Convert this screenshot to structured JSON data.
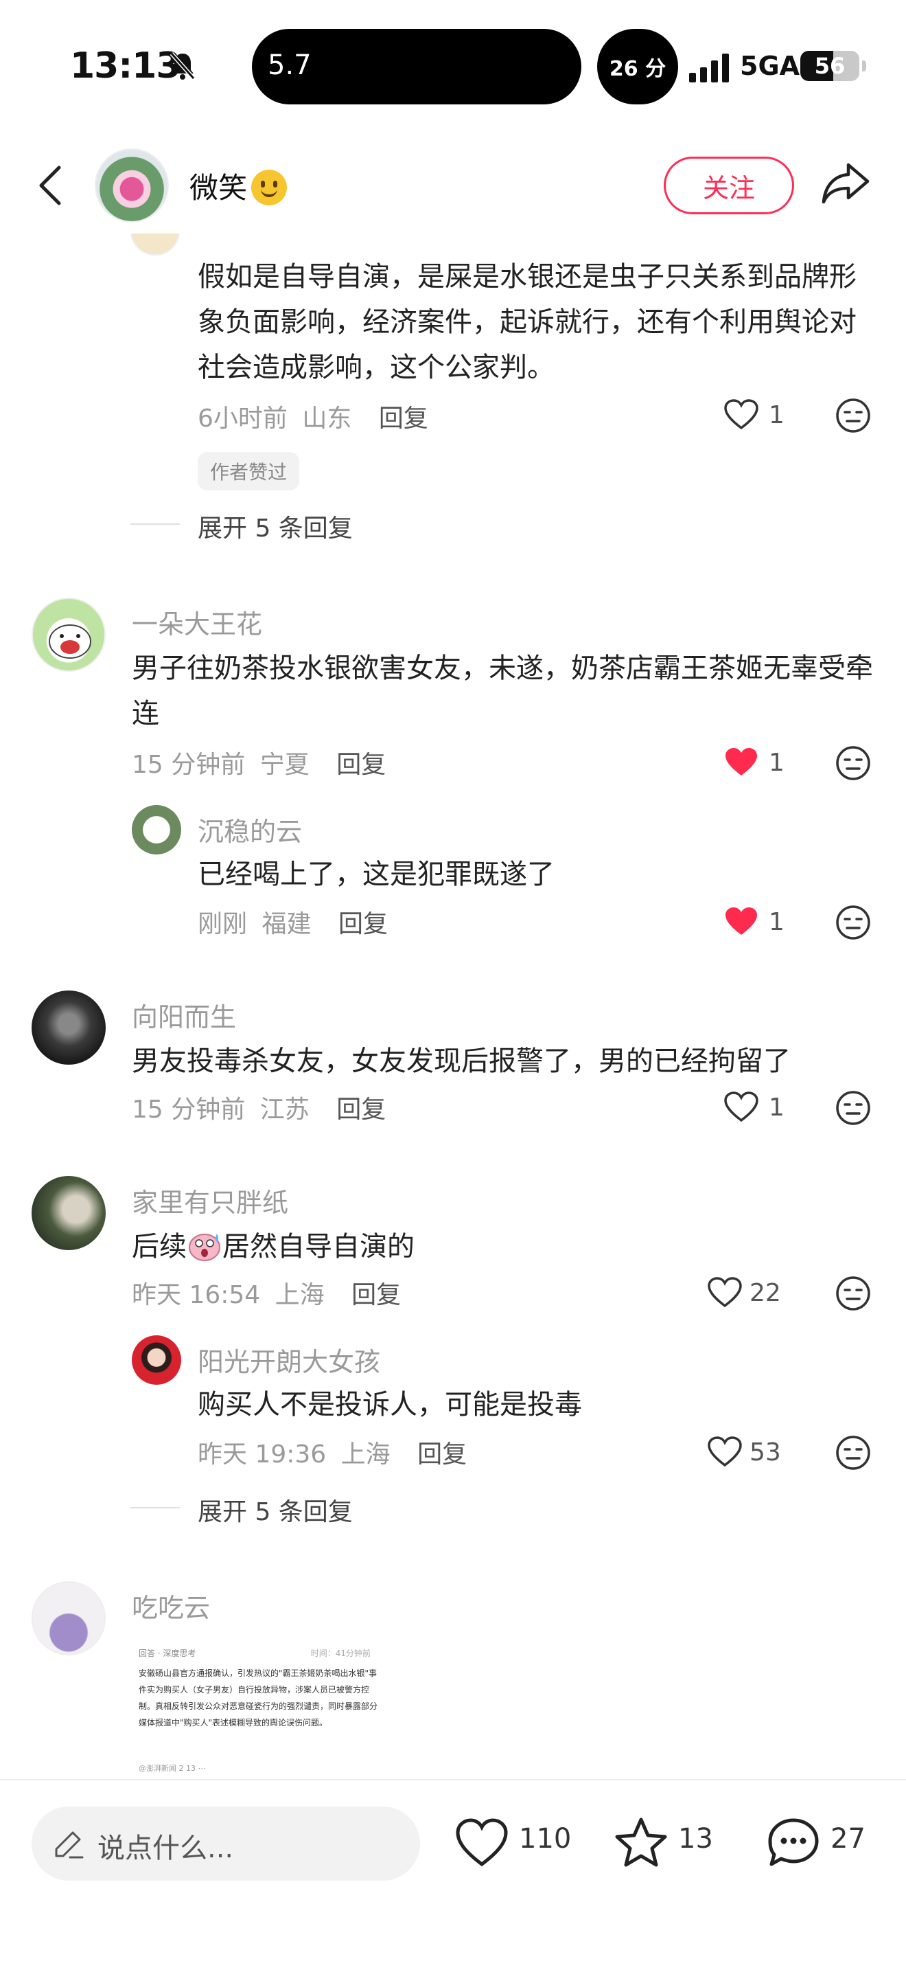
{
  "status_bar": {
    "time": "13:13",
    "island_text": "5.7",
    "timer": "26 分",
    "network": "5GA",
    "battery": "56",
    "battery_level": 0.56
  },
  "header": {
    "author_name": "微笑",
    "follow_label": "关注"
  },
  "comments": {
    "c0": {
      "text": "假如是自导自演，是屎是水银还是虫子只关系到品牌形象负面影响，经济案件，起诉就行，还有个利用舆论对社会造成影响，这个公家判。",
      "time": "6小时前",
      "location": "山东",
      "reply_label": "回复",
      "likes": "1",
      "liked": false,
      "tag": "作者赞过",
      "expand": "展开 5 条回复"
    },
    "c1": {
      "name": "一朵大王花",
      "text": "男子往奶茶投水银欲害女友，未遂，奶茶店霸王茶姬无辜受牵连",
      "time": "15 分钟前",
      "location": "宁夏",
      "reply_label": "回复",
      "likes": "1",
      "liked": true
    },
    "c1_reply": {
      "name": "沉稳的云",
      "text": "已经喝上了，这是犯罪既遂了",
      "time": "刚刚",
      "location": "福建",
      "reply_label": "回复",
      "likes": "1",
      "liked": true
    },
    "c2": {
      "name": "向阳而生",
      "text": "男友投毒杀女友，女友发现后报警了，男的已经拘留了",
      "time": "15 分钟前",
      "location": "江苏",
      "reply_label": "回复",
      "likes": "1",
      "liked": false
    },
    "c3": {
      "name": "家里有只胖纸",
      "text_before": "后续",
      "text_after": "居然自导自演的",
      "time": "昨天 16:54",
      "location": "上海",
      "reply_label": "回复",
      "likes": "22",
      "liked": false
    },
    "c3_reply": {
      "name": "阳光开朗大女孩",
      "text": "购买人不是投诉人，可能是投毒",
      "time": "昨天 19:36",
      "location": "上海",
      "reply_label": "回复",
      "likes": "53",
      "liked": false,
      "expand": "展开 5 条回复"
    },
    "c4": {
      "name": "吃吃云",
      "image": {
        "source_line": "回答 · 深度思考",
        "time_line": "时间：41分钟前",
        "body": "安徽砀山县官方通报确认，引发热议的\"霸王茶姬奶茶喝出水银\"事件实为购买人（女子男友）自行投放异物，涉案人员已被警方控制。真相反转引发公众对恶意碰瓷行为的强烈谴责，同时暴露部分媒体报道中\"购买人\"表述模糊导致的舆论误伤问题。",
        "footer": "@澎湃新闻  2  13  ⋯"
      }
    }
  },
  "bottom_bar": {
    "input_placeholder": "说点什么...",
    "likes": "110",
    "favorites": "13",
    "comments": "27"
  },
  "colors": {
    "accent": "#ff2d55",
    "liked_heart": "#ff2b4f",
    "meta_gray": "#9a9a9a"
  },
  "icons": [
    "back-arrow-icon",
    "share-icon",
    "heart-icon",
    "dislike-face-icon",
    "pencil-icon",
    "star-icon",
    "comment-bubble-icon",
    "bell-slash-icon",
    "signal-icon"
  ]
}
